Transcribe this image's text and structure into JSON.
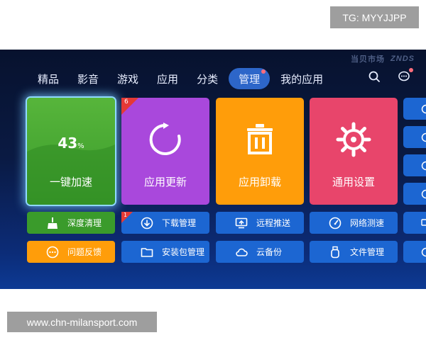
{
  "watermarks": {
    "top_right": "TG: MYYJJPP",
    "bottom_left": "www.chn-milansport.com"
  },
  "brand": {
    "name": "当贝市场",
    "sub": "ZNDS"
  },
  "nav": {
    "items": [
      {
        "label": "精品"
      },
      {
        "label": "影音"
      },
      {
        "label": "游戏"
      },
      {
        "label": "应用"
      },
      {
        "label": "分类"
      },
      {
        "label": "管理",
        "active": true
      },
      {
        "label": "我的应用"
      }
    ],
    "icons": [
      "search-icon",
      "message-icon"
    ]
  },
  "tiles": {
    "accelerate": {
      "percent": "43",
      "unit": "%",
      "label": "一键加速",
      "fill_level": 0.43,
      "color": "#3a9b2b"
    },
    "update": {
      "label": "应用更新",
      "badge": "6",
      "icon": "refresh-icon",
      "color": "#a948dc"
    },
    "uninstall": {
      "label": "应用卸载",
      "icon": "trash-icon",
      "color": "#ff9d0a"
    },
    "settings": {
      "label": "通用设置",
      "icon": "gear-icon",
      "color": "#e8456b"
    }
  },
  "buttons": {
    "deep_clean": {
      "label": "深度清理",
      "icon": "broom-icon"
    },
    "download_manage": {
      "label": "下载管理",
      "icon": "download-icon",
      "badge": "1"
    },
    "remote_push": {
      "label": "远程推送",
      "icon": "monitor-push-icon"
    },
    "network_speed": {
      "label": "网络测速",
      "icon": "speedometer-icon"
    },
    "feedback": {
      "label": "问题反馈",
      "icon": "chat-dots-icon"
    },
    "package_manage": {
      "label": "安装包管理",
      "icon": "folder-icon"
    },
    "cloud_backup": {
      "label": "云备份",
      "icon": "cloud-icon"
    },
    "file_manage": {
      "label": "文件管理",
      "icon": "usb-icon"
    }
  },
  "colors": {
    "accent_blue": "#1c66d2",
    "active_tab": "#2d66c9",
    "notify_dot": "#ff6d7c"
  }
}
